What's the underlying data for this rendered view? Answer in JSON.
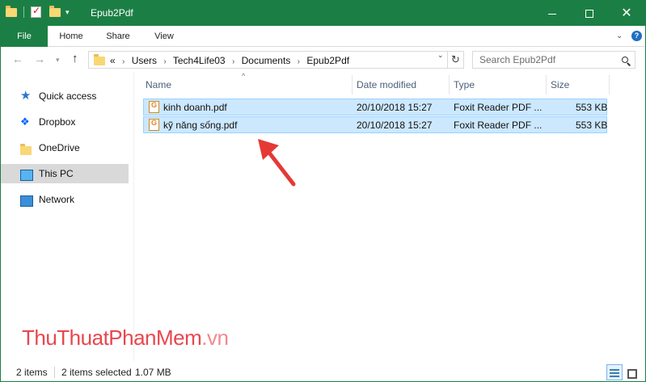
{
  "window": {
    "title": "Epub2Pdf"
  },
  "ribbon": {
    "tabs": [
      "File",
      "Home",
      "Share",
      "View"
    ]
  },
  "address": {
    "crumbs": [
      "«",
      "Users",
      "Tech4Life03",
      "Documents",
      "Epub2Pdf"
    ]
  },
  "search": {
    "placeholder": "Search Epub2Pdf"
  },
  "sidebar": {
    "items": [
      {
        "label": "Quick access",
        "icon": "star-icon"
      },
      {
        "label": "Dropbox",
        "icon": "dropbox-icon"
      },
      {
        "label": "OneDrive",
        "icon": "folder-icon"
      },
      {
        "label": "This PC",
        "icon": "computer-icon",
        "selected": true
      },
      {
        "label": "Network",
        "icon": "network-icon"
      }
    ]
  },
  "columns": {
    "name": "Name",
    "date": "Date modified",
    "type": "Type",
    "size": "Size"
  },
  "files": [
    {
      "name": "kinh doanh.pdf",
      "date": "20/10/2018 15:27",
      "type": "Foxit Reader PDF ...",
      "size": "553 KB",
      "selected": true
    },
    {
      "name": "kỹ năng sống.pdf",
      "date": "20/10/2018 15:27",
      "type": "Foxit Reader PDF ...",
      "size": "553 KB",
      "selected": true
    }
  ],
  "watermark": {
    "part1": "ThuThuat",
    "part2": "PhanMem",
    "part3": ".vn"
  },
  "status": {
    "items": "2 items",
    "selected": "2 items selected",
    "size": "1.07 MB"
  },
  "colors": {
    "titlebar": "#1b7f45",
    "selection": "#cce8ff",
    "annotation_arrow": "#e53935"
  }
}
